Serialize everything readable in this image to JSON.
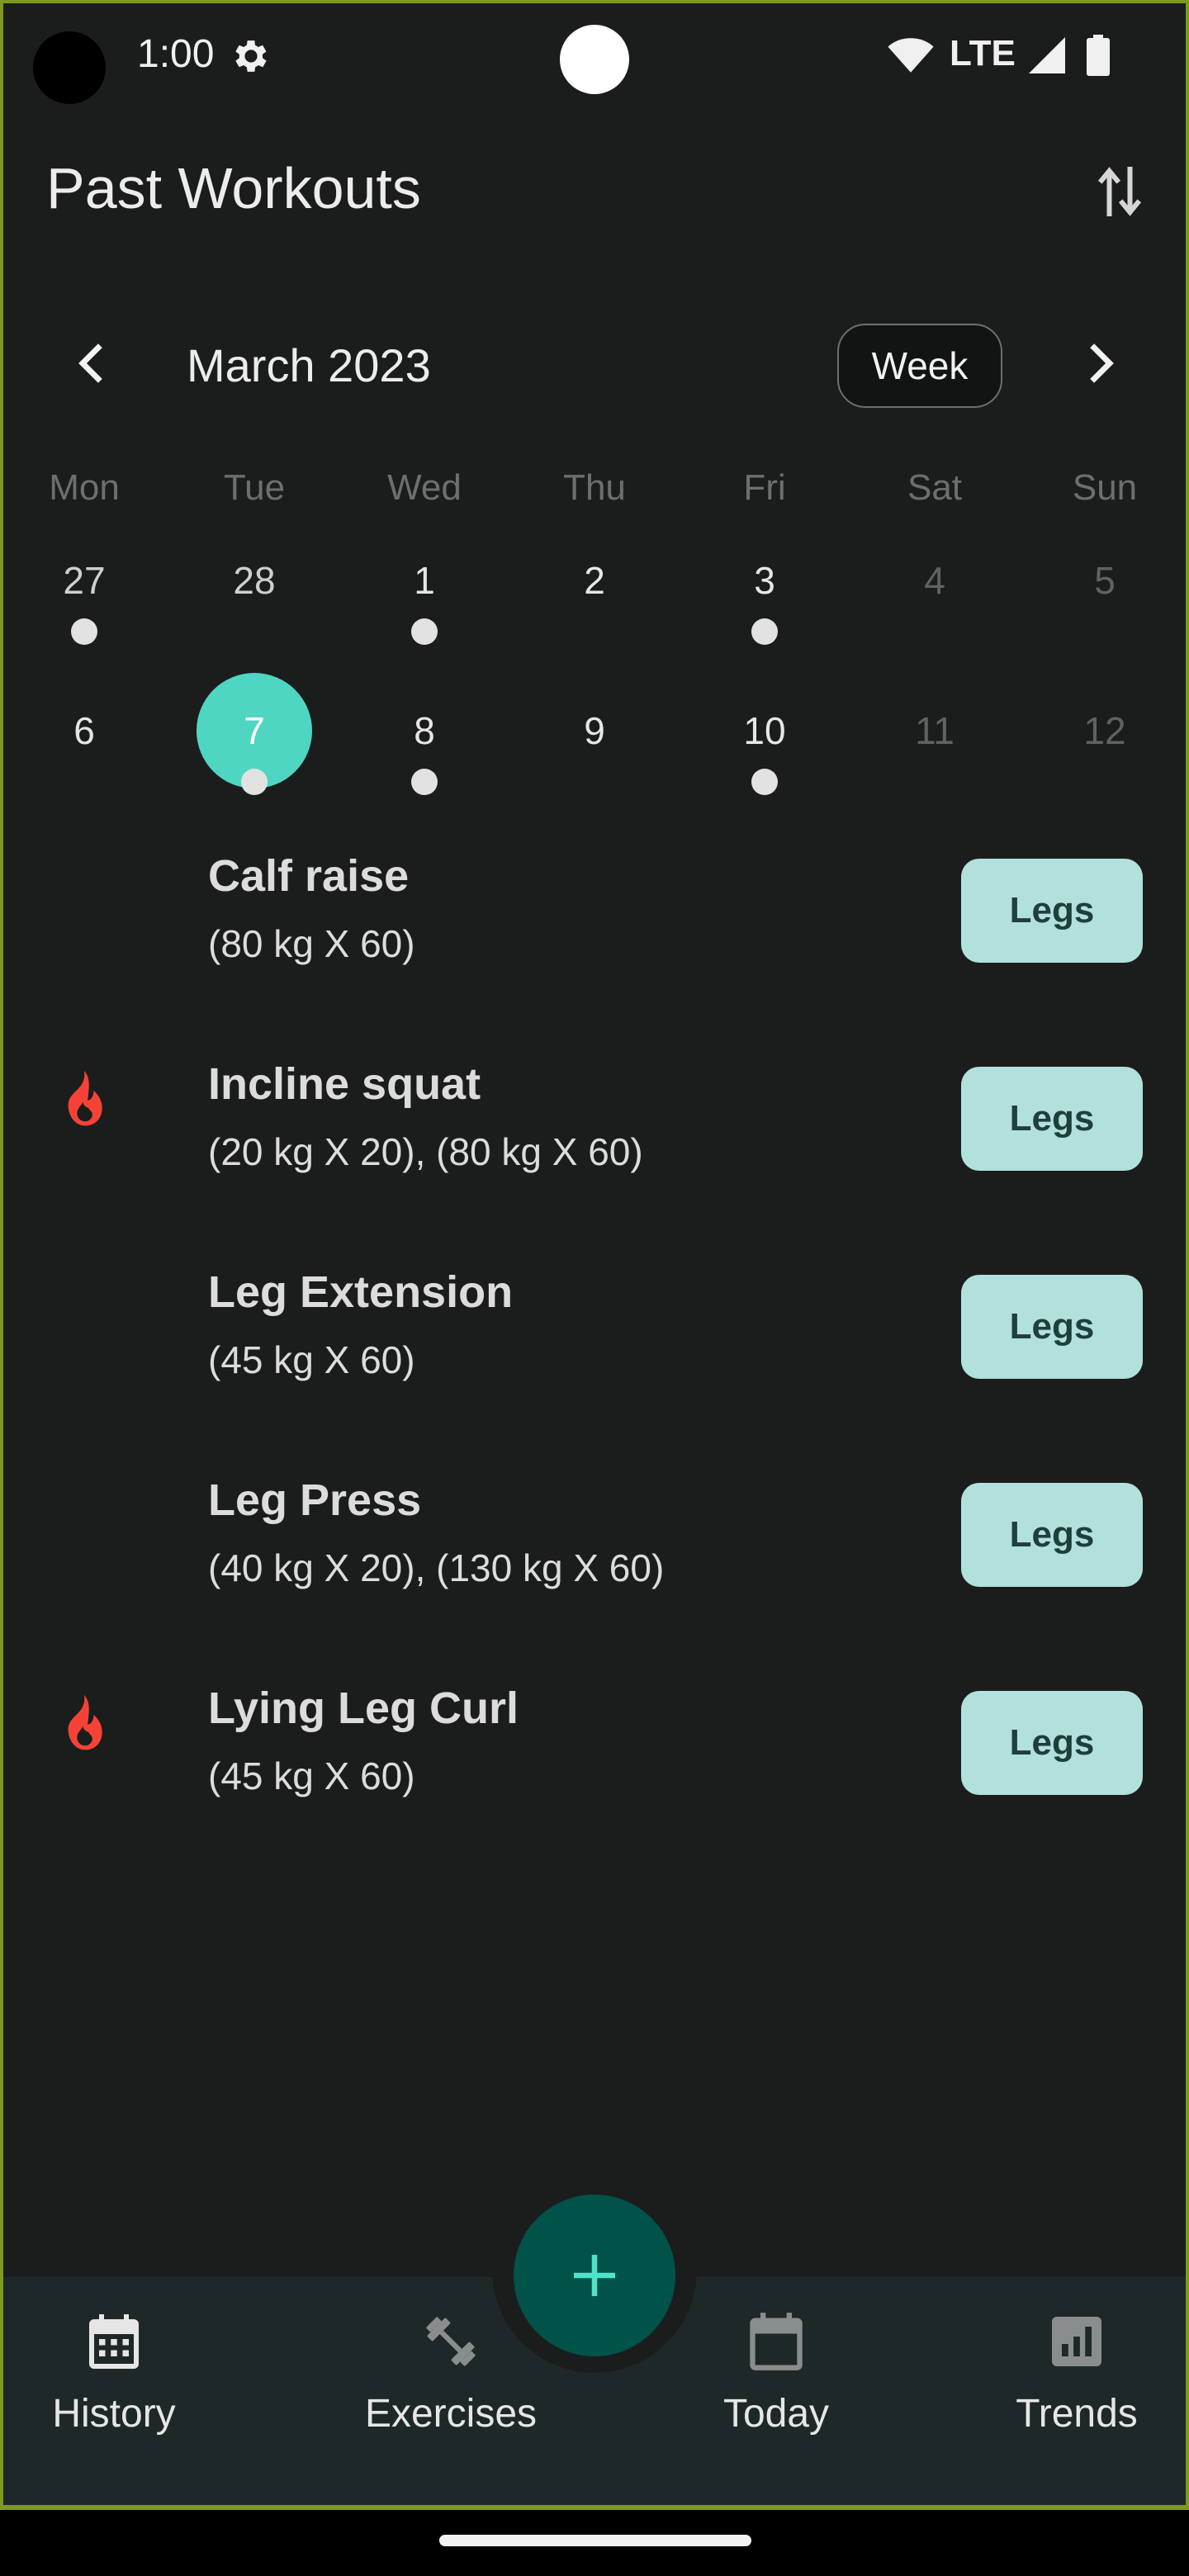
{
  "status_bar": {
    "time": "1:00",
    "network": "LTE"
  },
  "header": {
    "title": "Past Workouts"
  },
  "calendar": {
    "month_label": "March 2023",
    "view_toggle_label": "Week",
    "weekdays": [
      "Mon",
      "Tue",
      "Wed",
      "Thu",
      "Fri",
      "Sat",
      "Sun"
    ],
    "week1": [
      "27",
      "28",
      "1",
      "2",
      "3",
      "4",
      "5"
    ],
    "week2": [
      "6",
      "7",
      "8",
      "9",
      "10",
      "11",
      "12"
    ],
    "selected_day": "7"
  },
  "workouts": [
    {
      "name": "Calf raise",
      "sets": "(80 kg X 60)",
      "tag": "Legs",
      "record": false
    },
    {
      "name": "Incline squat",
      "sets": "(20 kg X 20), (80 kg X 60)",
      "tag": "Legs",
      "record": true
    },
    {
      "name": "Leg Extension",
      "sets": "(45 kg X 60)",
      "tag": "Legs",
      "record": false
    },
    {
      "name": "Leg Press",
      "sets": "(40 kg X 20), (130 kg X 60)",
      "tag": "Legs",
      "record": false
    },
    {
      "name": "Lying Leg Curl",
      "sets": "(45 kg X 60)",
      "tag": "Legs",
      "record": true
    }
  ],
  "nav": {
    "history": "History",
    "exercises": "Exercises",
    "today": "Today",
    "trends": "Trends"
  },
  "icons": {
    "settings": "gear-icon",
    "sort": "swap-vertical-icon",
    "prev": "chevron-left-icon",
    "next": "chevron-right-icon",
    "record": "flame-icon",
    "fab": "plus-icon",
    "history": "calendar-month-icon",
    "exercises": "dumbbell-icon",
    "today": "calendar-today-icon",
    "trends": "bar-chart-icon"
  },
  "colors": {
    "background": "#1b1d1d",
    "selected_day": "#4fd6c3",
    "tag_background": "#b2e0da",
    "fab": "#015248",
    "record": "#f44336"
  }
}
